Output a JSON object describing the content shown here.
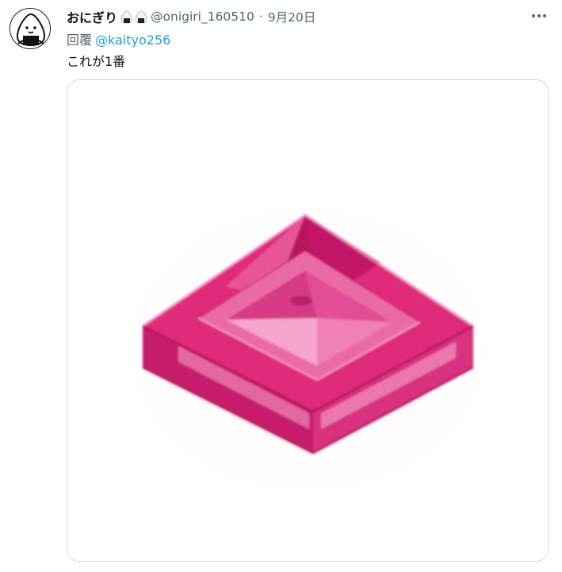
{
  "tweet": {
    "author": {
      "display_name": "おにぎり",
      "name_emoji": [
        "onigiri-icon",
        "onigiri-icon"
      ],
      "handle": "@onigiri_160510",
      "avatar_icon": "onigiri-face-avatar"
    },
    "separator": "·",
    "date": "9月20日",
    "more_icon": "more-horizontal-icon",
    "reply_to": {
      "prefix": "回覆",
      "mention": "@kaityo256"
    },
    "text": "これが1番",
    "media": {
      "icon": "transparent-pink-lego-slope-tile",
      "colors": {
        "brick": "#e0297a",
        "brick_light": "#f59ac6",
        "brick_dark": "#b8145c"
      }
    }
  },
  "colors": {
    "text_primary": "#0f1419",
    "text_secondary": "#536471",
    "link": "#1d9bf0",
    "border": "#cfd9de"
  }
}
